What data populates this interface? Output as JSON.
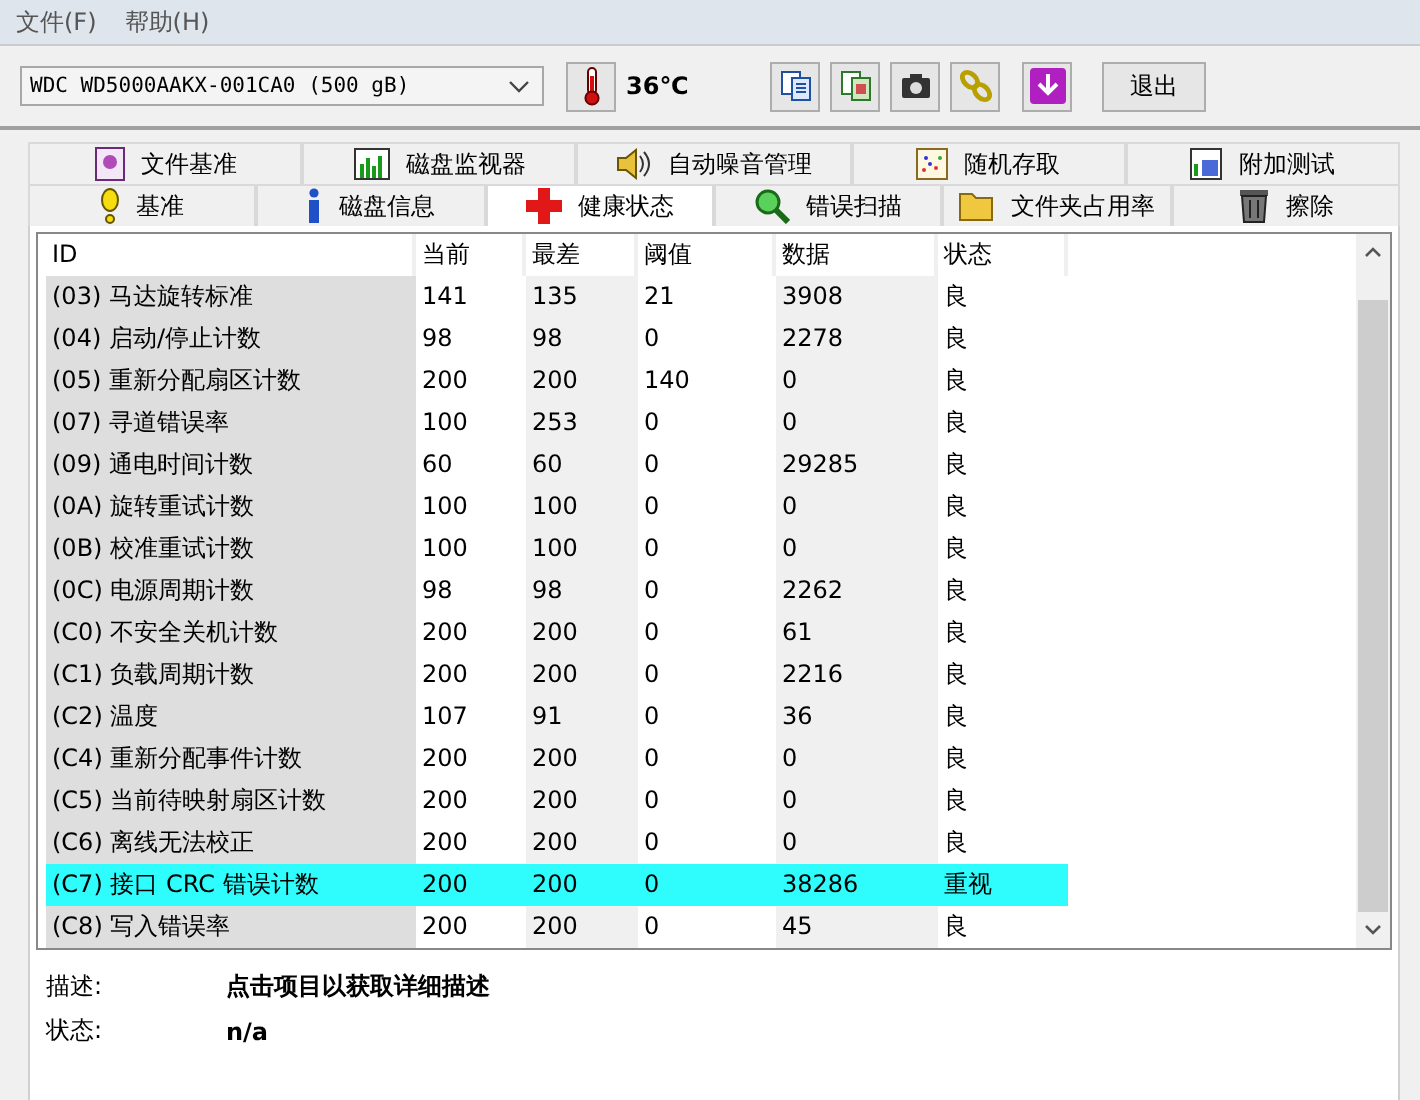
{
  "menu": [
    "文件(F)",
    "帮助(H)"
  ],
  "toolbar": {
    "drive": "WDC WD5000AAKX-001CA0 (500 gB)",
    "temperature": "36℃",
    "exit": "退出"
  },
  "tabs_top": [
    {
      "label": "文件基准",
      "selected": false
    },
    {
      "label": "磁盘监视器",
      "selected": false
    },
    {
      "label": "自动噪音管理",
      "selected": false
    },
    {
      "label": "随机存取",
      "selected": false
    },
    {
      "label": "附加测试",
      "selected": false
    }
  ],
  "tabs_bottom": [
    {
      "label": "基准",
      "selected": false
    },
    {
      "label": "磁盘信息",
      "selected": false
    },
    {
      "label": "健康状态",
      "selected": true
    },
    {
      "label": "错误扫描",
      "selected": false
    },
    {
      "label": "文件夹占用率",
      "selected": false
    },
    {
      "label": "擦除",
      "selected": false
    }
  ],
  "table": {
    "columns": [
      "ID",
      "当前",
      "最差",
      "阈值",
      "数据",
      "状态"
    ],
    "rows": [
      {
        "cells": [
          "(03) 马达旋转标准",
          "141",
          "135",
          "21",
          "3908",
          "良"
        ],
        "warning": false
      },
      {
        "cells": [
          "(04) 启动/停止计数",
          "98",
          "98",
          "0",
          "2278",
          "良"
        ],
        "warning": false
      },
      {
        "cells": [
          "(05) 重新分配扇区计数",
          "200",
          "200",
          "140",
          "0",
          "良"
        ],
        "warning": false
      },
      {
        "cells": [
          "(07) 寻道错误率",
          "100",
          "253",
          "0",
          "0",
          "良"
        ],
        "warning": false
      },
      {
        "cells": [
          "(09) 通电时间计数",
          "60",
          "60",
          "0",
          "29285",
          "良"
        ],
        "warning": false
      },
      {
        "cells": [
          "(0A) 旋转重试计数",
          "100",
          "100",
          "0",
          "0",
          "良"
        ],
        "warning": false
      },
      {
        "cells": [
          "(0B) 校准重试计数",
          "100",
          "100",
          "0",
          "0",
          "良"
        ],
        "warning": false
      },
      {
        "cells": [
          "(0C) 电源周期计数",
          "98",
          "98",
          "0",
          "2262",
          "良"
        ],
        "warning": false
      },
      {
        "cells": [
          "(C0) 不安全关机计数",
          "200",
          "200",
          "0",
          "61",
          "良"
        ],
        "warning": false
      },
      {
        "cells": [
          "(C1) 负载周期计数",
          "200",
          "200",
          "0",
          "2216",
          "良"
        ],
        "warning": false
      },
      {
        "cells": [
          "(C2) 温度",
          "107",
          "91",
          "0",
          "36",
          "良"
        ],
        "warning": false
      },
      {
        "cells": [
          "(C4) 重新分配事件计数",
          "200",
          "200",
          "0",
          "0",
          "良"
        ],
        "warning": false
      },
      {
        "cells": [
          "(C5) 当前待映射扇区计数",
          "200",
          "200",
          "0",
          "0",
          "良"
        ],
        "warning": false
      },
      {
        "cells": [
          "(C6) 离线无法校正",
          "200",
          "200",
          "0",
          "0",
          "良"
        ],
        "warning": false
      },
      {
        "cells": [
          "(C7) 接口 CRC 错误计数",
          "200",
          "200",
          "0",
          "38286",
          "重视"
        ],
        "warning": true
      },
      {
        "cells": [
          "(C8) 写入错误率",
          "200",
          "200",
          "0",
          "45",
          "良"
        ],
        "warning": false
      }
    ]
  },
  "details": [
    {
      "label": "描述:",
      "value": "点击项目以获取详细描述"
    },
    {
      "label": "状态:",
      "value": "n/a"
    }
  ]
}
